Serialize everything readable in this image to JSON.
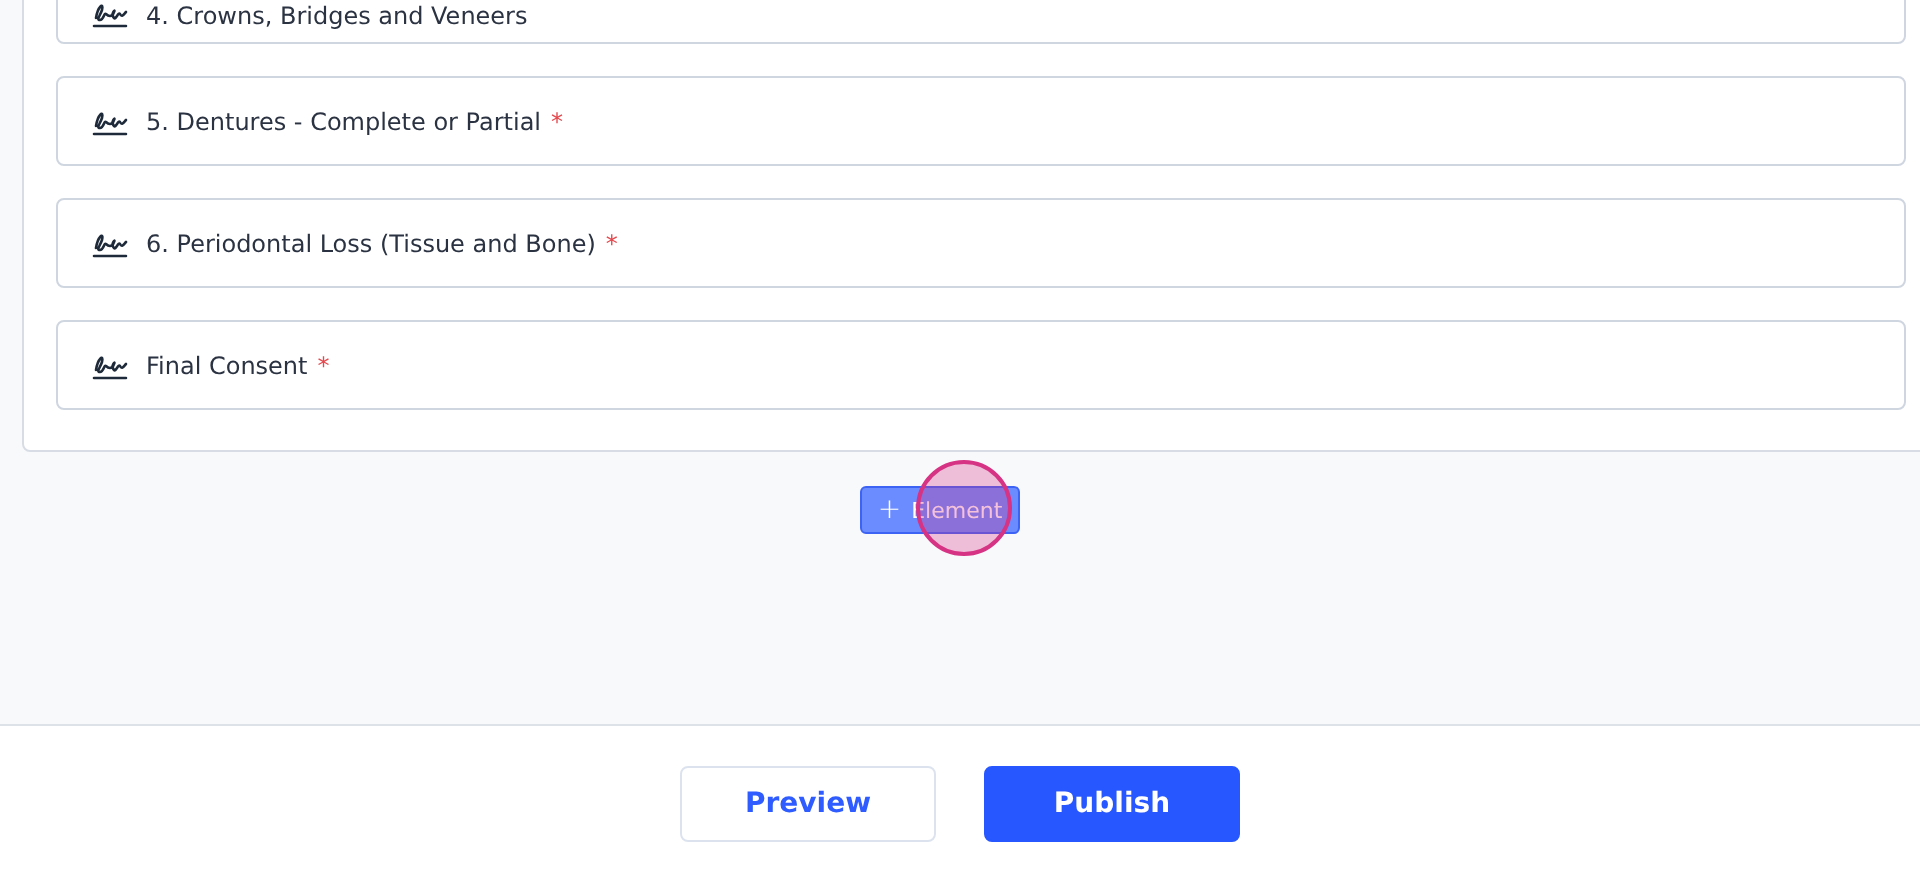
{
  "fields": [
    {
      "label": "4. Crowns, Bridges and Veneers",
      "required": false
    },
    {
      "label": "5. Dentures - Complete or Partial",
      "required": true
    },
    {
      "label": "6. Periodontal Loss (Tissue and Bone)",
      "required": true
    },
    {
      "label": "Final Consent",
      "required": true
    }
  ],
  "add_button": {
    "icon": "+",
    "label": "Element"
  },
  "required_mark": "*",
  "footer": {
    "buttons": [
      {
        "label": "Preview",
        "kind": "secondary"
      },
      {
        "label": "Publish",
        "kind": "primary"
      }
    ]
  }
}
